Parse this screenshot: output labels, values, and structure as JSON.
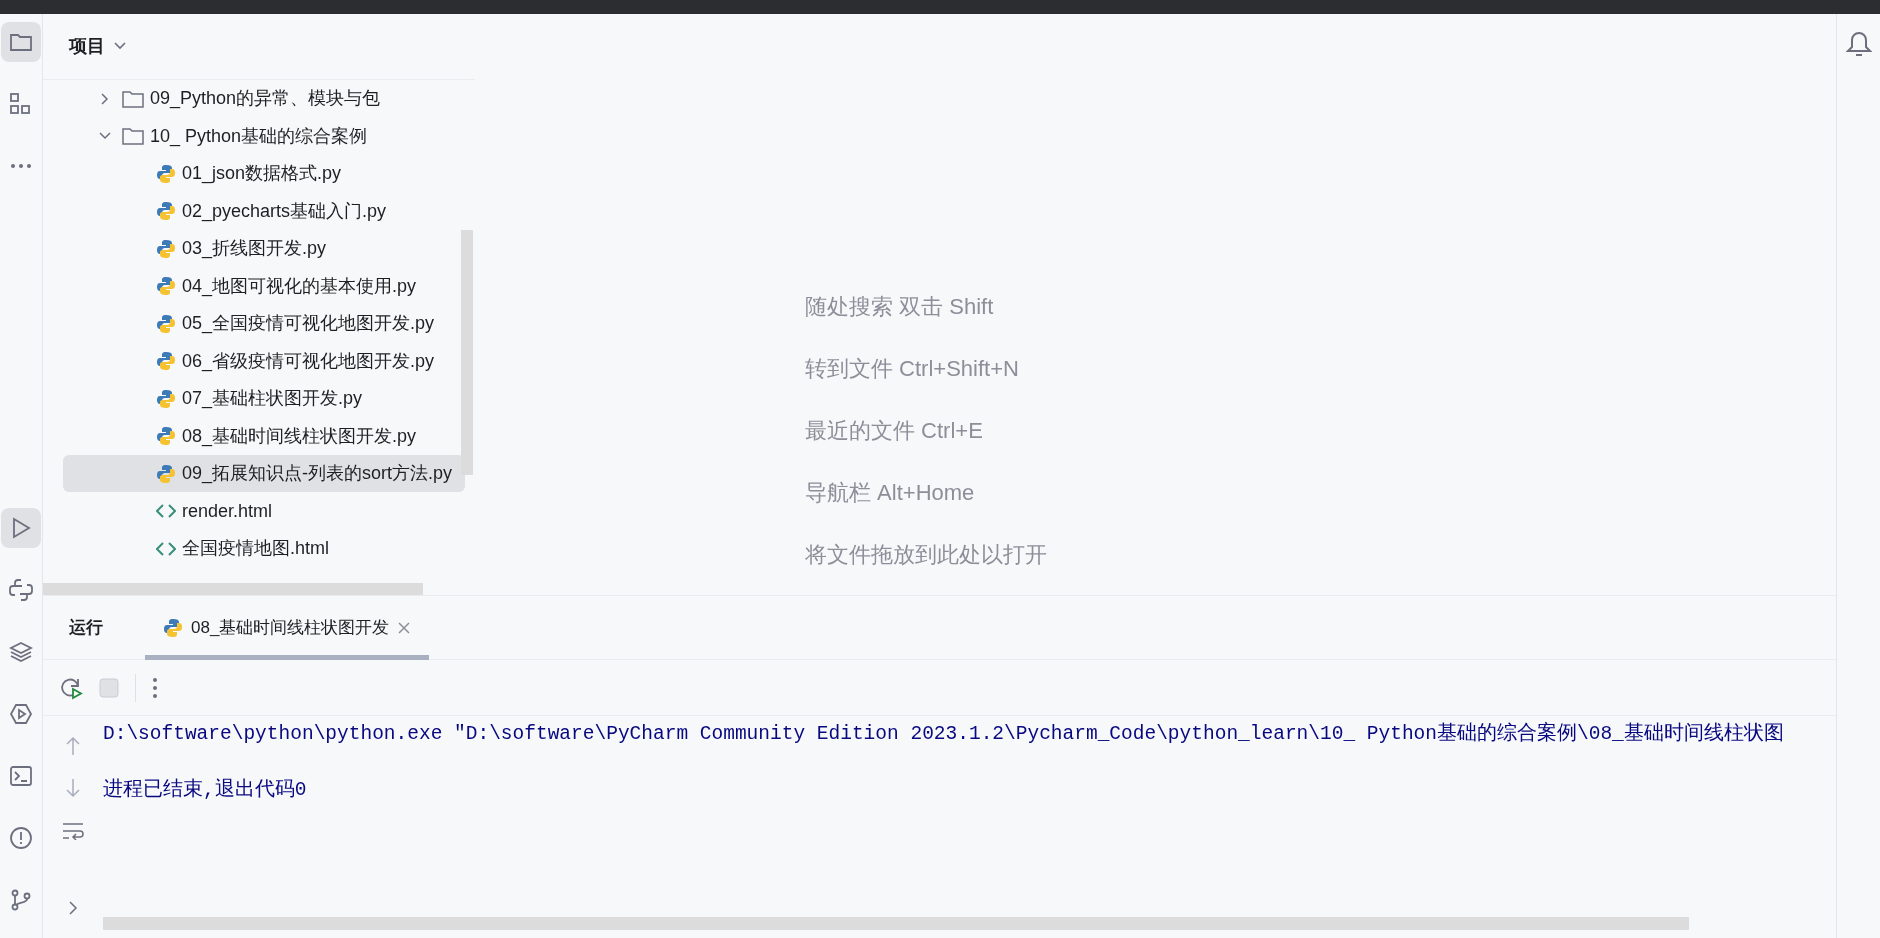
{
  "left_toolbar": [
    {
      "kind": "folder",
      "selected": true
    },
    {
      "kind": "structure",
      "selected": false
    },
    {
      "kind": "more",
      "selected": false
    },
    {
      "kind": "run",
      "selected": true
    },
    {
      "kind": "python",
      "selected": false
    },
    {
      "kind": "layers",
      "selected": false
    },
    {
      "kind": "services",
      "selected": false
    },
    {
      "kind": "terminal",
      "selected": false
    },
    {
      "kind": "problems",
      "selected": false
    },
    {
      "kind": "git",
      "selected": false
    }
  ],
  "project_panel": {
    "title": "项目",
    "tree": [
      {
        "kind": "folder",
        "label": "09_Python的异常、模块与包",
        "expanded": false,
        "selected": false
      },
      {
        "kind": "folder",
        "label": "10_ Python基础的综合案例",
        "expanded": true,
        "selected": false,
        "children": [
          {
            "kind": "python",
            "label": "01_json数据格式.py",
            "selected": false
          },
          {
            "kind": "python",
            "label": "02_pyecharts基础入门.py",
            "selected": false
          },
          {
            "kind": "python",
            "label": "03_折线图开发.py",
            "selected": false
          },
          {
            "kind": "python",
            "label": "04_地图可视化的基本使用.py",
            "selected": false
          },
          {
            "kind": "python",
            "label": "05_全国疫情可视化地图开发.py",
            "selected": false
          },
          {
            "kind": "python",
            "label": "06_省级疫情可视化地图开发.py",
            "selected": false
          },
          {
            "kind": "python",
            "label": "07_基础柱状图开发.py",
            "selected": false
          },
          {
            "kind": "python",
            "label": "08_基础时间线柱状图开发.py",
            "selected": false
          },
          {
            "kind": "python",
            "label": "09_拓展知识点-列表的sort方法.py",
            "selected": true
          },
          {
            "kind": "html",
            "label": "render.html",
            "selected": false
          },
          {
            "kind": "html",
            "label": "全国疫情地图.html",
            "selected": false
          }
        ]
      }
    ]
  },
  "editor_hints": [
    "随处搜索 双击 Shift",
    "转到文件 Ctrl+Shift+N",
    "最近的文件 Ctrl+E",
    "导航栏 Alt+Home",
    "将文件拖放到此处以打开"
  ],
  "run_panel": {
    "title": "运行",
    "tabs": [
      {
        "label": "08_基础时间线柱状图开发",
        "selected": true
      }
    ],
    "console": [
      "D:\\software\\python\\python.exe \"D:\\software\\PyCharm Community Edition 2023.1.2\\Pycharm_Code\\python_learn\\10_ Python基础的综合案例\\08_基础时间线柱状图",
      "进程已结束,退出代码0"
    ]
  }
}
